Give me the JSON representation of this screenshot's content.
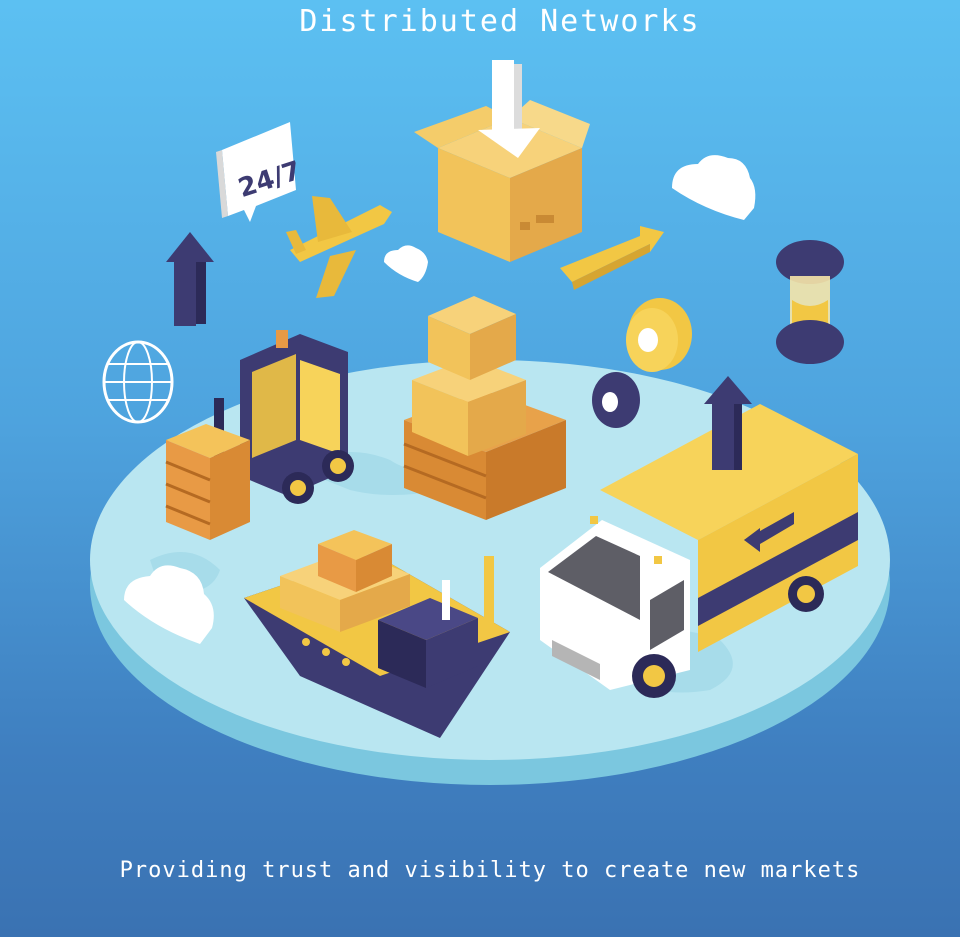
{
  "header": {
    "title": "Distributed Networks"
  },
  "footer": {
    "tagline": "Providing trust and visibility to create new markets"
  },
  "illustration": {
    "badge_text": "24/7",
    "icons": [
      "24-7-chat-bubble-icon",
      "airplane-icon",
      "open-box-icon",
      "down-arrow-icon",
      "up-arrow-icon",
      "right-arrow-icon",
      "cloud-icon",
      "hourglass-icon",
      "location-pin-icon",
      "globe-icon",
      "forklift-icon",
      "cargo-boxes-icon",
      "cargo-ship-icon",
      "delivery-truck-icon"
    ],
    "colors": {
      "navy": "#3d3b72",
      "yellow": "#f2c744",
      "box": "#f4c35a",
      "orange": "#e89a45",
      "platform": "#b9e6f1",
      "white": "#ffffff"
    }
  }
}
